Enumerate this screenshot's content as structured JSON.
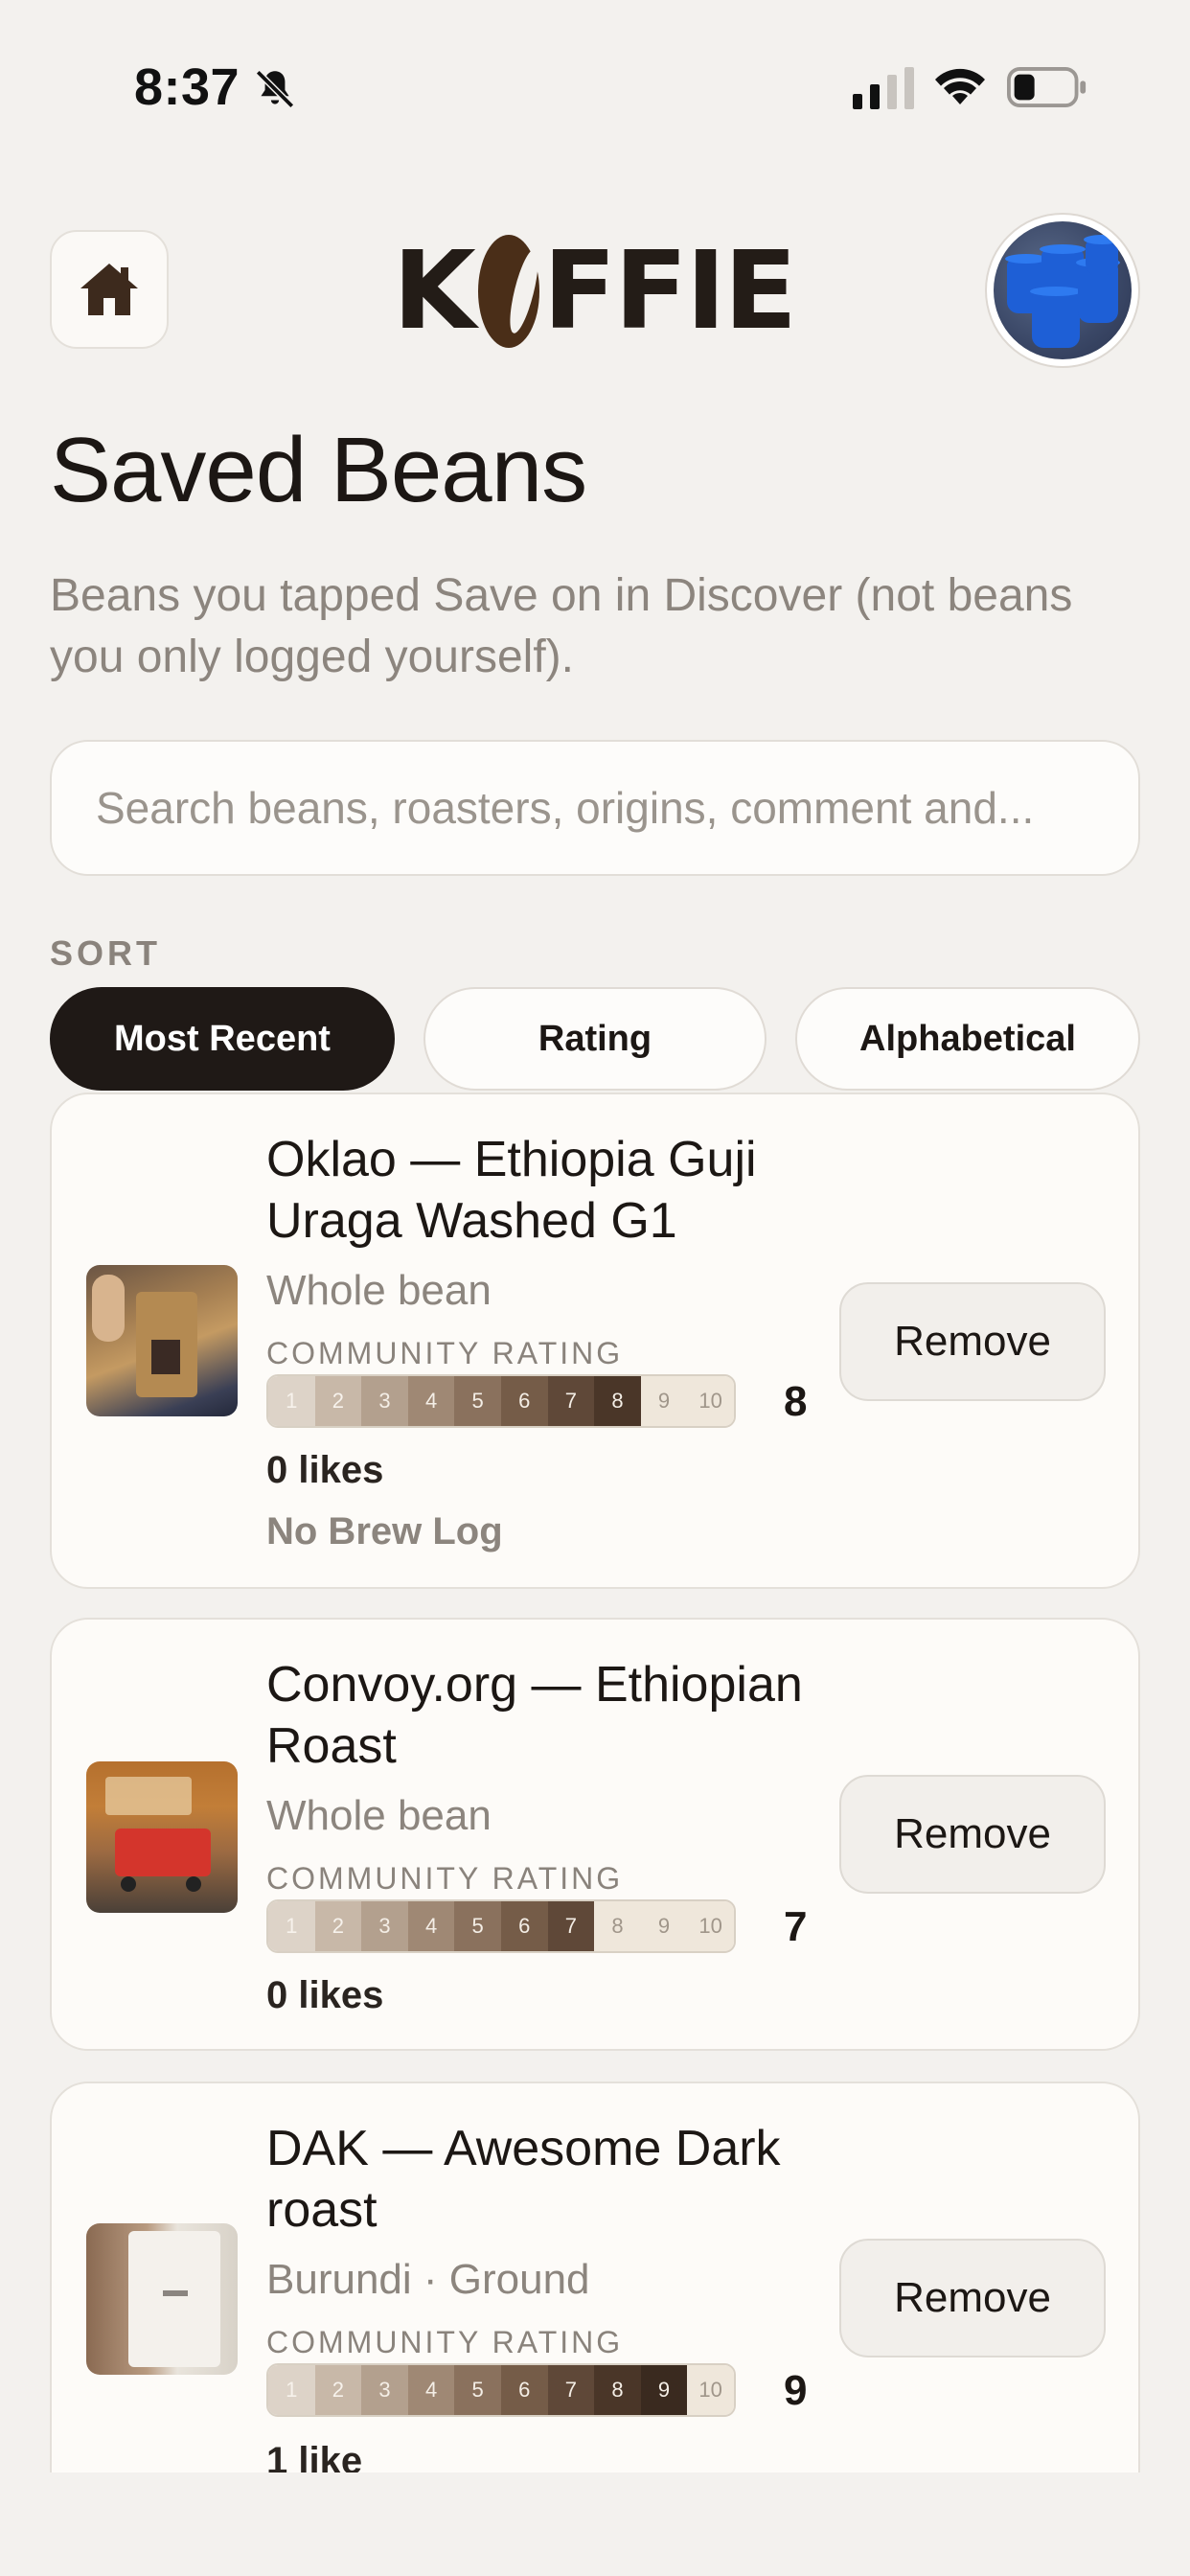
{
  "status_bar": {
    "time": "8:37"
  },
  "header": {
    "logo_before": "K",
    "logo_after": "FFIE"
  },
  "page": {
    "title": "Saved Beans",
    "subtitle": "Beans you tapped Save on in Discover (not beans you only logged yourself)."
  },
  "search": {
    "placeholder": "Search beans, roasters, origins, comment and..."
  },
  "sort": {
    "label": "SORT",
    "options": [
      "Most Recent",
      "Rating",
      "Alphabetical"
    ],
    "selected": "Most Recent"
  },
  "rating_scale": [
    "1",
    "2",
    "3",
    "4",
    "5",
    "6",
    "7",
    "8",
    "9",
    "10"
  ],
  "beans": [
    {
      "title": "Oklao — Ethiopia Guji Uraga Washed G1",
      "meta": "Whole bean",
      "rating_label": "COMMUNITY RATING",
      "rating": 8,
      "rating_text": "8",
      "likes": "0 likes",
      "brew_log": "No Brew Log",
      "remove_label": "Remove"
    },
    {
      "title": "Convoy.org — Ethiopian Roast",
      "meta": "Whole bean",
      "rating_label": "COMMUNITY RATING",
      "rating": 7,
      "rating_text": "7",
      "likes": "0 likes",
      "remove_label": "Remove"
    },
    {
      "title": "DAK — Awesome Dark roast",
      "meta": "Burundi · Ground",
      "rating_label": "COMMUNITY RATING",
      "rating": 9,
      "rating_text": "9",
      "likes": "1 like",
      "remove_label": "Remove"
    }
  ],
  "colors": {
    "background": "#f3f1ee",
    "active_pill": "#1f1916",
    "logo_bean": "#4a2e18"
  }
}
